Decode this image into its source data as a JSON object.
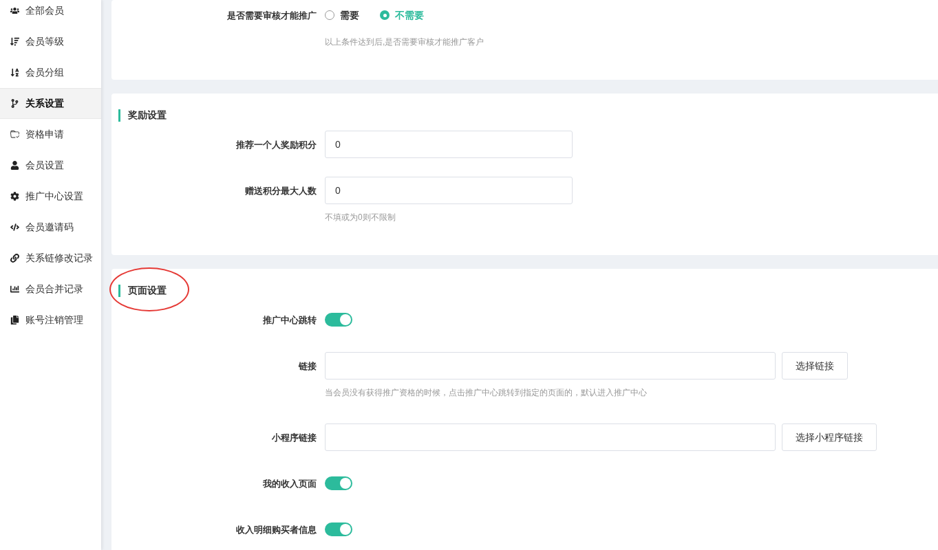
{
  "sidebar": {
    "items": [
      {
        "label": "全部会员",
        "selected": false
      },
      {
        "label": "会员等级",
        "selected": false
      },
      {
        "label": "会员分组",
        "selected": false
      },
      {
        "label": "关系设置",
        "selected": true
      },
      {
        "label": "资格申请",
        "selected": false
      },
      {
        "label": "会员设置",
        "selected": false
      },
      {
        "label": "推广中心设置",
        "selected": false
      },
      {
        "label": "会员邀请码",
        "selected": false
      },
      {
        "label": "关系链修改记录",
        "selected": false
      },
      {
        "label": "会员合并记录",
        "selected": false
      },
      {
        "label": "账号注销管理",
        "selected": false
      }
    ]
  },
  "sections": [
    {
      "rows": [
        {
          "kind": "radio",
          "label": "是否需要审核才能推广",
          "options": [
            {
              "label": "需要",
              "selected": false
            },
            {
              "label": "不需要",
              "selected": true
            }
          ],
          "hint": "以上条件达到后,是否需要审核才能推广客户"
        }
      ]
    },
    {
      "title": "奖励设置",
      "rows": [
        {
          "kind": "input",
          "label": "推荐一个人奖励积分",
          "value": "0"
        },
        {
          "kind": "input",
          "label": "赠送积分最大人数",
          "value": "0",
          "hint": "不填或为0则不限制"
        }
      ]
    },
    {
      "title": "页面设置",
      "annotated": true,
      "rows": [
        {
          "kind": "toggle",
          "label": "推广中心跳转",
          "on": true
        },
        {
          "kind": "input_button",
          "label": "链接",
          "button": "选择链接",
          "hint": "当会员没有获得推广资格的时候，点击推广中心跳转到指定的页面的，默认进入推广中心"
        },
        {
          "kind": "input_button",
          "label": "小程序链接",
          "button": "选择小程序链接"
        },
        {
          "kind": "toggle",
          "label": "我的收入页面",
          "on": true
        },
        {
          "kind": "toggle",
          "label": "收入明细购买者信息",
          "on": true
        }
      ]
    }
  ]
}
